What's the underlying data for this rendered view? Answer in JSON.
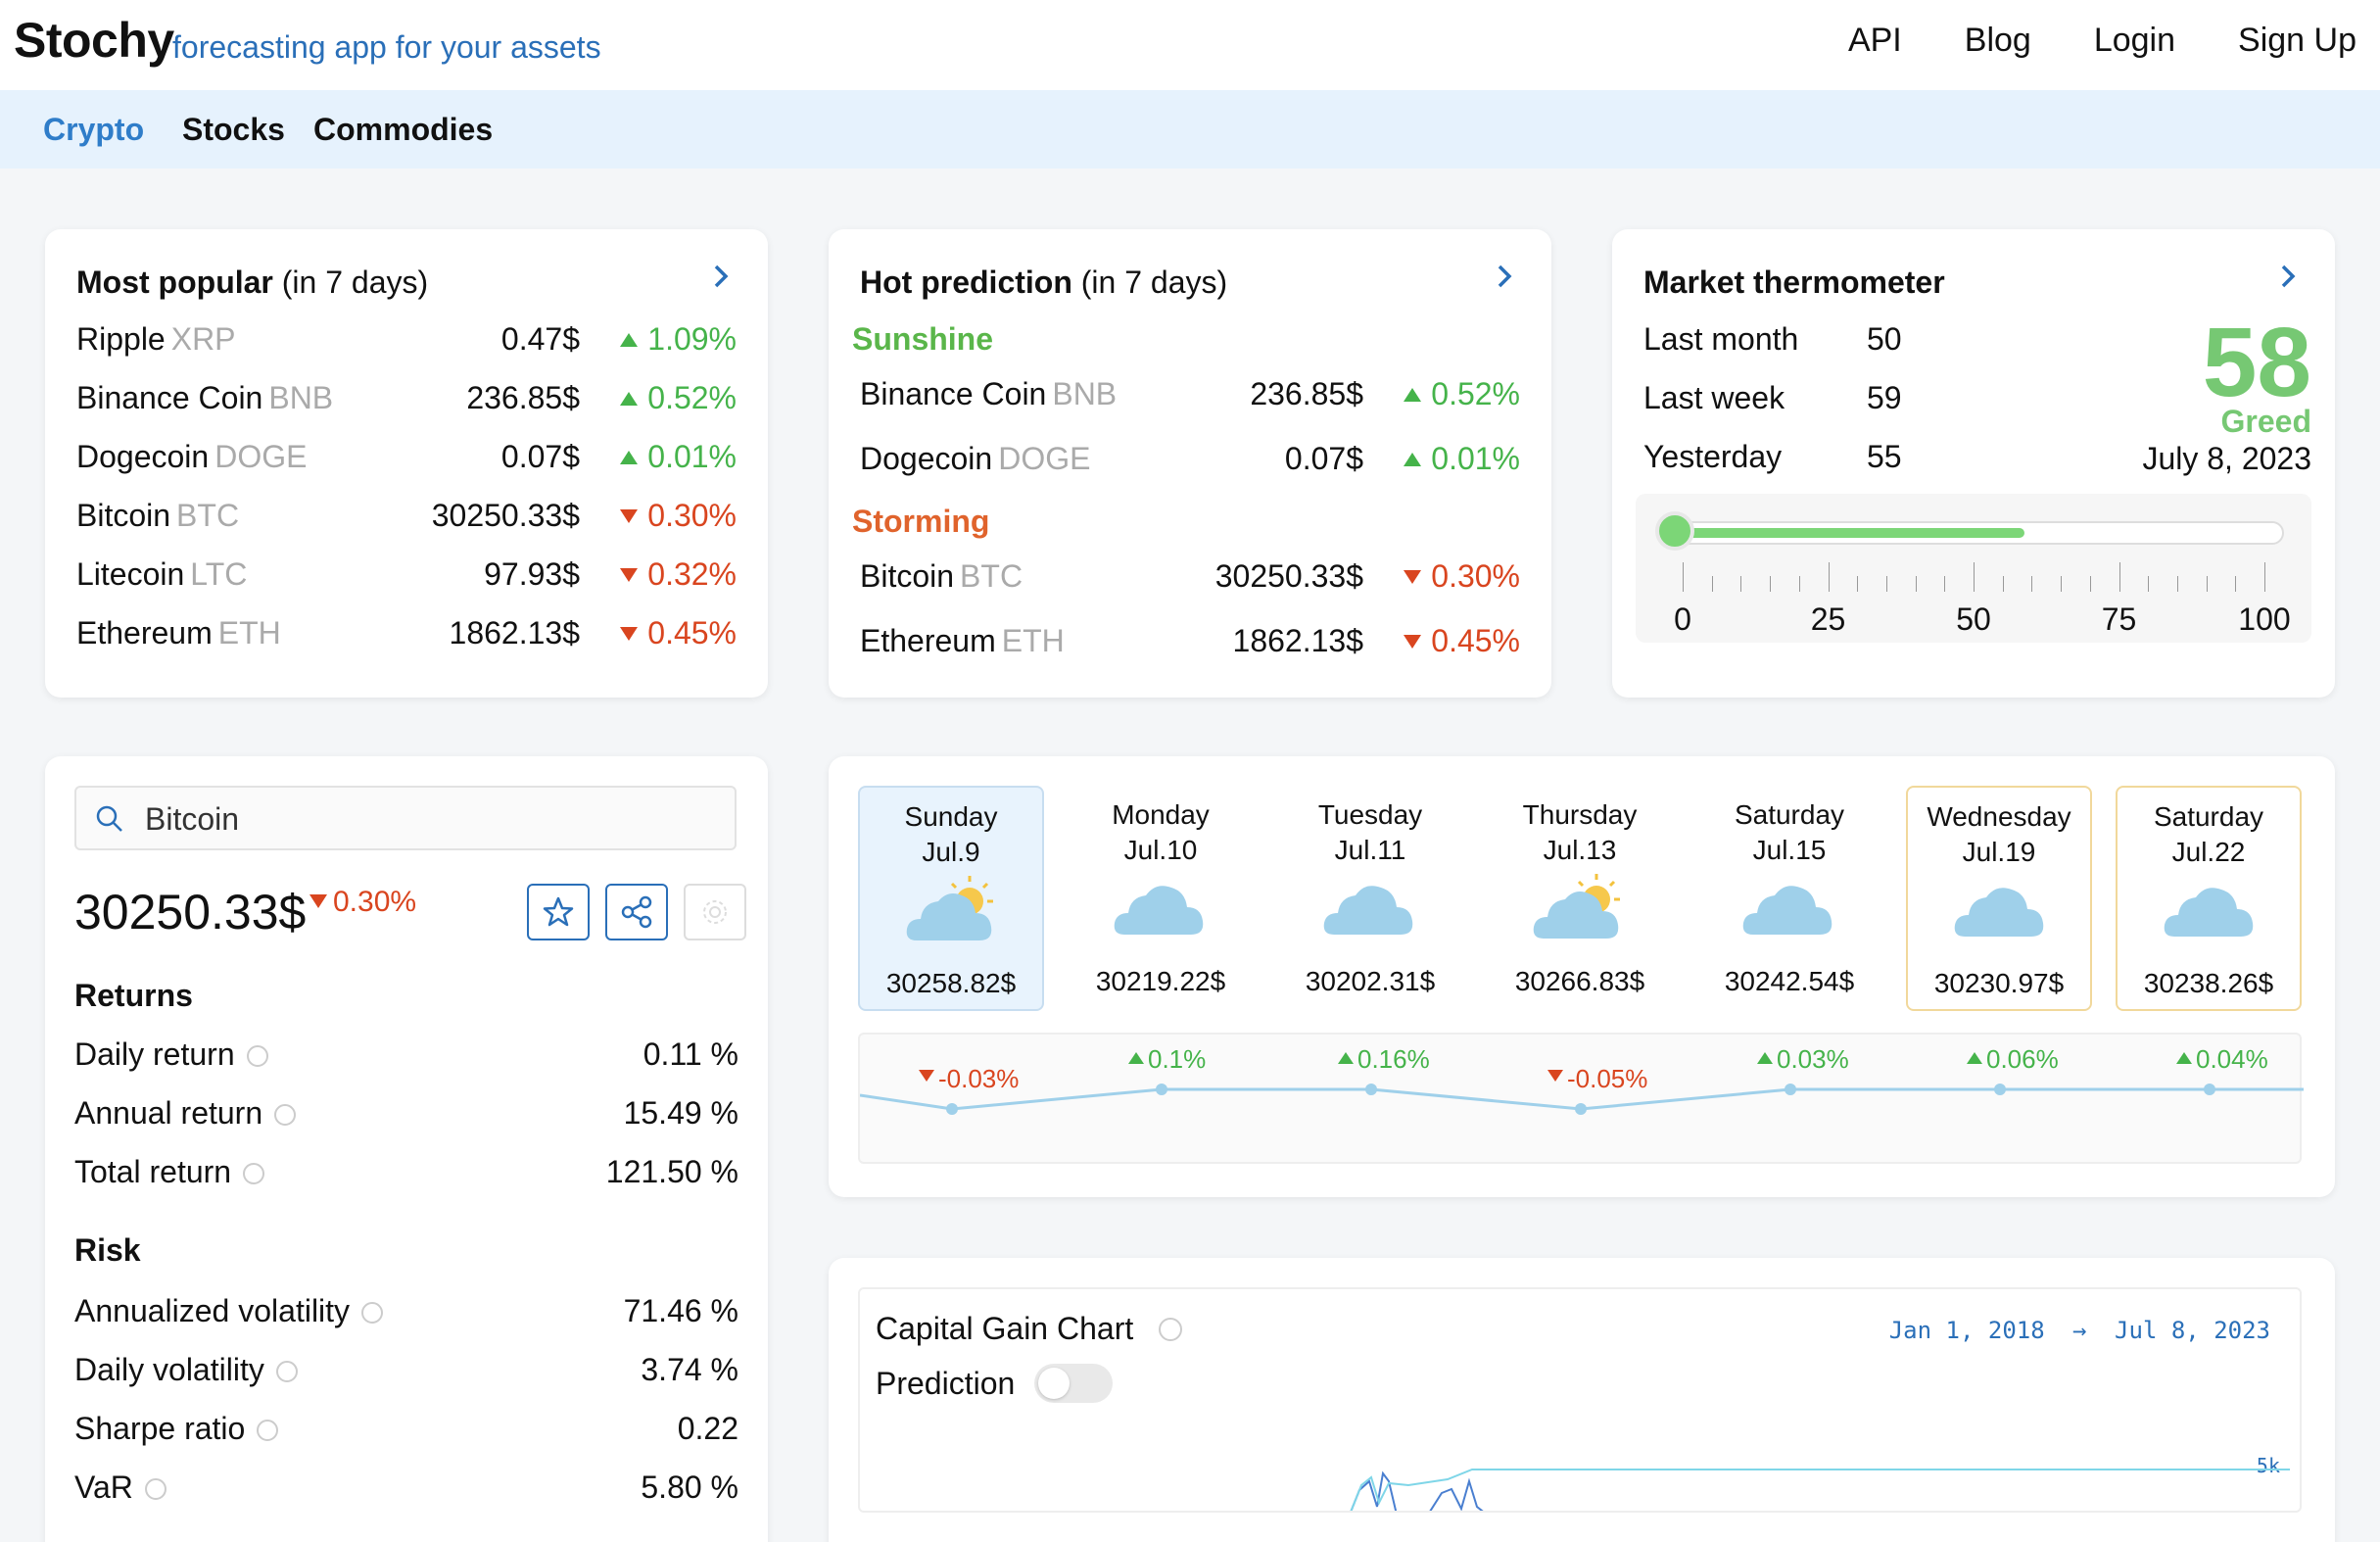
{
  "header": {
    "logo": "Stochy",
    "tagline": "forecasting app for your assets",
    "nav": [
      "API",
      "Blog",
      "Login",
      "Sign Up"
    ]
  },
  "subnav": {
    "tabs": [
      "Crypto",
      "Stocks",
      "Commodies"
    ],
    "active": "Crypto"
  },
  "most_popular": {
    "title": "Most popular",
    "subtitle": "(in 7 days)",
    "items": [
      {
        "name": "Ripple",
        "symbol": "XRP",
        "price": "0.47$",
        "change": "1.09%",
        "direction": "up"
      },
      {
        "name": "Binance Coin",
        "symbol": "BNB",
        "price": "236.85$",
        "change": "0.52%",
        "direction": "up"
      },
      {
        "name": "Dogecoin",
        "symbol": "DOGE",
        "price": "0.07$",
        "change": "0.01%",
        "direction": "up"
      },
      {
        "name": "Bitcoin",
        "symbol": "BTC",
        "price": "30250.33$",
        "change": "0.30%",
        "direction": "down"
      },
      {
        "name": "Litecoin",
        "symbol": "LTC",
        "price": "97.93$",
        "change": "0.32%",
        "direction": "down"
      },
      {
        "name": "Ethereum",
        "symbol": "ETH",
        "price": "1862.13$",
        "change": "0.45%",
        "direction": "down"
      }
    ]
  },
  "hot_prediction": {
    "title": "Hot prediction",
    "subtitle": "(in 7 days)",
    "sunshine_label": "Sunshine",
    "storming_label": "Storming",
    "sunshine": [
      {
        "name": "Binance Coin",
        "symbol": "BNB",
        "price": "236.85$",
        "change": "0.52%",
        "direction": "up"
      },
      {
        "name": "Dogecoin",
        "symbol": "DOGE",
        "price": "0.07$",
        "change": "0.01%",
        "direction": "up"
      }
    ],
    "storming": [
      {
        "name": "Bitcoin",
        "symbol": "BTC",
        "price": "30250.33$",
        "change": "0.30%",
        "direction": "down"
      },
      {
        "name": "Ethereum",
        "symbol": "ETH",
        "price": "1862.13$",
        "change": "0.45%",
        "direction": "down"
      }
    ]
  },
  "thermometer": {
    "title": "Market thermometer",
    "rows": [
      {
        "label": "Last month",
        "value": "50"
      },
      {
        "label": "Last week",
        "value": "59"
      },
      {
        "label": "Yesterday",
        "value": "55"
      }
    ],
    "score": "58",
    "score_fraction": 0.58,
    "sentiment": "Greed",
    "date": "July 8, 2023",
    "scale_labels": [
      "0",
      "25",
      "50",
      "75",
      "100"
    ],
    "accent": "#76c873"
  },
  "asset": {
    "search_value": "Bitcoin",
    "price": "30250.33$",
    "change": "0.30%",
    "returns_title": "Returns",
    "returns": [
      {
        "label": "Daily return",
        "value": "0.11 %"
      },
      {
        "label": "Annual return",
        "value": "15.49 %"
      },
      {
        "label": "Total return",
        "value": "121.50 %"
      }
    ],
    "risk_title": "Risk",
    "risk": [
      {
        "label": "Annualized volatility",
        "value": "71.46 %"
      },
      {
        "label": "Daily volatility",
        "value": "3.74 %"
      },
      {
        "label": "Sharpe ratio",
        "value": "0.22"
      },
      {
        "label": "VaR",
        "value": "5.80 %"
      }
    ]
  },
  "forecast": {
    "days": [
      {
        "day": "Sunday",
        "date": "Jul.9",
        "price": "30258.82$",
        "icon": "partly-sunny-icon"
      },
      {
        "day": "Monday",
        "date": "Jul.10",
        "price": "30219.22$",
        "icon": "cloud-icon"
      },
      {
        "day": "Tuesday",
        "date": "Jul.11",
        "price": "30202.31$",
        "icon": "cloud-icon"
      },
      {
        "day": "Thursday",
        "date": "Jul.13",
        "price": "30266.83$",
        "icon": "partly-sunny-icon"
      },
      {
        "day": "Saturday",
        "date": "Jul.15",
        "price": "30242.54$",
        "icon": "cloud-icon"
      },
      {
        "day": "Wednesday",
        "date": "Jul.19",
        "price": "30230.97$",
        "icon": "cloud-icon"
      },
      {
        "day": "Saturday",
        "date": "Jul.22",
        "price": "30238.26$",
        "icon": "cloud-icon"
      }
    ],
    "changes": [
      "-0.03%",
      "0.1%",
      "0.16%",
      "-0.05%",
      "0.03%",
      "0.06%",
      "0.04%"
    ]
  },
  "capital_gain": {
    "title": "Capital Gain Chart",
    "start": "Jan 1, 2018",
    "arrow": "→",
    "end": "Jul 8, 2023",
    "prediction_label": "Prediction",
    "axis_label": "5k"
  },
  "colors": {
    "up": "#45b34a",
    "down": "#d9451f",
    "brand": "#2a6fb8",
    "line": "#9fd0ea"
  }
}
